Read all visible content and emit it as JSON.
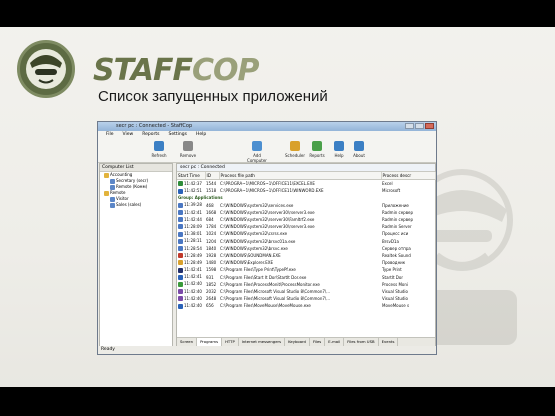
{
  "brand": {
    "part1": "STAFF",
    "part2": "COP"
  },
  "caption": "Список запущенных приложений",
  "window": {
    "title": "secr pc : Connected - StaffCop",
    "menu": [
      "File",
      "View",
      "Reports",
      "Settings",
      "Help"
    ],
    "toolbar": [
      {
        "label": "Refresh",
        "icon": "refresh-icon",
        "color": "#3b7fc4"
      },
      {
        "label": "Remove",
        "icon": "remove-icon",
        "color": "#888888"
      },
      {
        "label": "Add Computer",
        "icon": "add-computer-icon",
        "color": "#4c8fd0"
      },
      {
        "label": "Scheduler",
        "icon": "scheduler-icon",
        "color": "#d9a12c"
      },
      {
        "label": "Reports",
        "icon": "reports-icon",
        "color": "#4aa04a"
      },
      {
        "label": "Help",
        "icon": "help-icon",
        "color": "#3b7fc4"
      },
      {
        "label": "About",
        "icon": "about-icon",
        "color": "#3b7fc4"
      }
    ],
    "computer_list": {
      "header": "Computer List",
      "tree": [
        "Accounting",
        "Secretary (secr)",
        "Remote (Комм)",
        "Remote",
        "Visitor",
        "Sales (sales)"
      ]
    },
    "tab": "secr pc : Connected",
    "columns": [
      "Start Time",
      "ID",
      "Process file path",
      "Process descr"
    ],
    "rows": [
      {
        "time": "11:42:37",
        "id": "1544",
        "path": "C:\\PROGRA~1\\MICROS~1\\OFFICE11\\EXCEL.EXE",
        "descr": "Excel",
        "color": "#2f8c3a"
      },
      {
        "time": "11:42:51",
        "id": "1518",
        "path": "C:\\PROGRA~1\\MICROS~1\\OFFICE11\\WINWORD.EXE",
        "descr": "Microsoft",
        "color": "#2a62b8"
      },
      {
        "time": "",
        "id": "",
        "path": "Group: Applications",
        "descr": "",
        "group": true
      },
      {
        "time": "11:39:28",
        "id": "468",
        "path": "C:\\WINDOWS\\system32\\services.exe",
        "descr": "Приложение",
        "color": "#4a77c2"
      },
      {
        "time": "11:42:41",
        "id": "1668",
        "path": "C:\\WINDOWS\\system32\\rserver30\\rserver3.exe",
        "descr": "Radmin сервер",
        "color": "#4a77c2"
      },
      {
        "time": "11:42:44",
        "id": "684",
        "path": "C:\\WINDOWS\\system32\\rserver30\\FamItrf2.exe",
        "descr": "Radmin сервер",
        "color": "#4a77c2"
      },
      {
        "time": "11:28:09",
        "id": "1784",
        "path": "C:\\WINDOWS\\system32\\rserver30\\rserver3.exe",
        "descr": "Radmin Server",
        "color": "#4a77c2"
      },
      {
        "time": "11:38:01",
        "id": "1024",
        "path": "C:\\WINDOWS\\system32\\csrss.exe",
        "descr": "Процесс иси",
        "color": "#4a77c2"
      },
      {
        "time": "11:28:11",
        "id": "1204",
        "path": "C:\\WINDOWS\\system32\\brsvc01a.exe",
        "descr": "BrsvD1a",
        "color": "#4a77c2"
      },
      {
        "time": "11:28:54",
        "id": "1840",
        "path": "C:\\WINDOWS\\system32\\brsvc.exe",
        "descr": "Сервер отпра",
        "color": "#4a77c2"
      },
      {
        "time": "11:28:49",
        "id": "1928",
        "path": "C:\\WINDOWS\\SOUNDMAN.EXE",
        "descr": "Realtek Sound",
        "color": "#c0392b"
      },
      {
        "time": "11:28:49",
        "id": "1480",
        "path": "C:\\WINDOWS\\Explorer.EXE",
        "descr": "Проводник",
        "color": "#d9a12c"
      },
      {
        "time": "11:42:41",
        "id": "1598",
        "path": "C:\\Program Files\\Type Print\\TypePf.exe",
        "descr": "Type Print",
        "color": "#22306b"
      },
      {
        "time": "11:42:41",
        "id": "931",
        "path": "C:\\Program Files\\Start It Dor\\StartIt Dor.exe",
        "descr": "StartIt Dor",
        "color": "#2a62b8"
      },
      {
        "time": "11:42:40",
        "id": "1852",
        "path": "C:\\Program Files\\ProcessMonit\\ProcessMonitor.exe",
        "descr": "Process Moni",
        "color": "#3a9a3a"
      },
      {
        "time": "11:42:40",
        "id": "2032",
        "path": "C:\\Program Files\\Microsoft Visual Studio 8\\Common7\\...",
        "descr": "Visual Studio",
        "color": "#7b4aa8"
      },
      {
        "time": "11:42:40",
        "id": "2648",
        "path": "C:\\Program Files\\Microsoft Visual Studio 8\\Common7\\...",
        "descr": "Visual Studio",
        "color": "#7b4aa8"
      },
      {
        "time": "11:42:40",
        "id": "656",
        "path": "C:\\Program Files\\MoveMouse\\MoveMouse.exe",
        "descr": "MoveMouse s",
        "color": "#2a62b8"
      }
    ],
    "bottom_tabs": [
      "Screen",
      "Programs",
      "HTTP",
      "Internet messengers",
      "Keyboard",
      "Files",
      "E-mail",
      "Files from USB",
      "Events"
    ],
    "status": "Ready"
  }
}
